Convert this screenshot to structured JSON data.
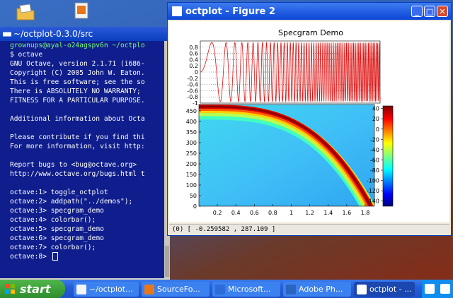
{
  "terminal": {
    "title": "~/octplot-0.3.0/src",
    "glyph": "■■",
    "lines": [
      {
        "text": "grownups@ayal-o24agspv6n ~/octplo",
        "color": "green"
      },
      {
        "text": "$ octave",
        "color": "white"
      },
      {
        "text": "GNU Octave, version 2.1.71 (i686-",
        "color": "white"
      },
      {
        "text": "Copyright (C) 2005 John W. Eaton.",
        "color": "white"
      },
      {
        "text": "This is free software; see the so",
        "color": "white"
      },
      {
        "text": "There is ABSOLUTELY NO WARRANTY;",
        "color": "white"
      },
      {
        "text": "FITNESS FOR A PARTICULAR PURPOSE.",
        "color": "white"
      },
      {
        "text": "",
        "color": "white"
      },
      {
        "text": "Additional information about Octa",
        "color": "white"
      },
      {
        "text": "",
        "color": "white"
      },
      {
        "text": "Please contribute if you find thi",
        "color": "white"
      },
      {
        "text": "For more information, visit http:",
        "color": "white"
      },
      {
        "text": "",
        "color": "white"
      },
      {
        "text": "Report bugs to <bug@octave.org>",
        "color": "white"
      },
      {
        "text": "http://www.octave.org/bugs.html t",
        "color": "white"
      },
      {
        "text": "",
        "color": "white"
      },
      {
        "text": "octave:1> toggle_octplot",
        "color": "white"
      },
      {
        "text": "octave:2> addpath(\"../demos\");",
        "color": "white"
      },
      {
        "text": "octave:3> specgram_demo",
        "color": "white"
      },
      {
        "text": "octave:4> colorbar();",
        "color": "white"
      },
      {
        "text": "octave:5> specgram_demo",
        "color": "white"
      },
      {
        "text": "octave:6> specgram_demo",
        "color": "white"
      },
      {
        "text": "octave:7> colorbar();",
        "color": "white"
      },
      {
        "text": "octave:8> ",
        "color": "white"
      }
    ]
  },
  "figure": {
    "title": "octplot - Figure 2",
    "status": "(0) [ -0.259582 , 287.109 ]",
    "min_glyph": "_",
    "max_glyph": "□",
    "close_glyph": "✕"
  },
  "chart_data": [
    {
      "type": "line",
      "title": "Specgram Demo",
      "xlim": [
        0,
        2
      ],
      "ylim": [
        -1,
        1
      ],
      "yticks": [
        "0.8",
        "0.6",
        "0.4",
        "0.2",
        "0",
        "-0.2",
        "-0.4",
        "-0.6",
        "-0.8",
        "-1"
      ],
      "series": [
        {
          "color": "#e01010",
          "signal": "chirp: sin(2π·t²·f) sweeping upward in frequency over t 0–2"
        }
      ],
      "grid": "dotted"
    },
    {
      "type": "heatmap",
      "xlim": [
        0,
        1.9
      ],
      "ylim": [
        0,
        480
      ],
      "xticks": [
        "0.2",
        "0.4",
        "0.6",
        "0.8",
        "1",
        "1.2",
        "1.4",
        "1.6",
        "1.8"
      ],
      "yticks": [
        "450",
        "400",
        "350",
        "300",
        "250",
        "200",
        "150",
        "100",
        "50",
        "0"
      ],
      "colormap": "jet",
      "ridge": "high-intensity band starting near 470 at t=0, curving down to 0 near t=1.85"
    },
    {
      "type": "colorbar",
      "ticks": [
        "40",
        "20",
        "0",
        "-20",
        "-40",
        "-60",
        "-80",
        "-100",
        "-120",
        "-140"
      ],
      "range": [
        -150,
        45
      ]
    }
  ],
  "taskbar": {
    "start_label": "start",
    "buttons": [
      {
        "label": "~/octplot...",
        "icon_color": "#f5f5f5",
        "active": false
      },
      {
        "label": "SourceFo...",
        "icon_color": "#e8761a",
        "active": false
      },
      {
        "label": "Microsoft...",
        "icon_color": "#2c6bd8",
        "active": false
      },
      {
        "label": "Adobe Ph...",
        "icon_color": "#2a63c0",
        "active": false
      },
      {
        "label": "octplot - ...",
        "icon_color": "#ffffff",
        "active": true
      }
    ]
  }
}
